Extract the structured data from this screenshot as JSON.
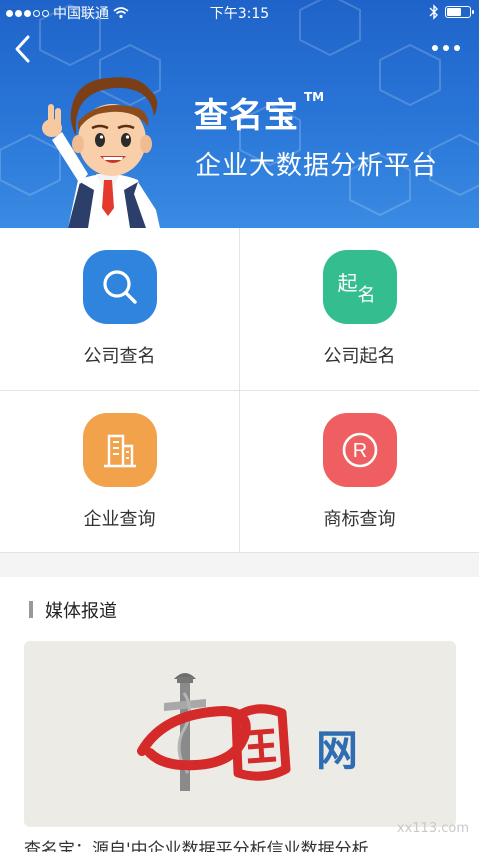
{
  "status_bar": {
    "carrier": "中国联通",
    "time": "下午3:15",
    "signal_dots_filled": 3,
    "signal_dots_total": 5,
    "battery_level": 0.6,
    "icons": [
      "signal-dots-icon",
      "wifi-icon",
      "bluetooth-icon",
      "battery-icon"
    ]
  },
  "nav": {
    "back_icon": "chevron-left-icon",
    "more_icon": "more-dots-icon"
  },
  "banner": {
    "brand": "查名宝",
    "trademark": "TM",
    "subtitle": "企业大数据分析平台",
    "mascot": "businessman-mascot-icon",
    "colors": {
      "top": "#1f63c9",
      "bottom": "#3a8be3"
    }
  },
  "services": [
    {
      "label": "公司查名",
      "icon": "search-icon",
      "color": "#2f85dd"
    },
    {
      "label": "公司起名",
      "icon": "起名",
      "color": "#34bd8e"
    },
    {
      "label": "企业查询",
      "icon": "building-icon",
      "color": "#f3a24c"
    },
    {
      "label": "商标查询",
      "icon": "registered-icon",
      "color": "#ef5f61"
    }
  ],
  "media": {
    "section_title": "媒体报道",
    "card_logo_text": "网",
    "article_title": "查名宝：源自'中企业数据平分析信业数据分析"
  },
  "watermark": "xx113.com"
}
